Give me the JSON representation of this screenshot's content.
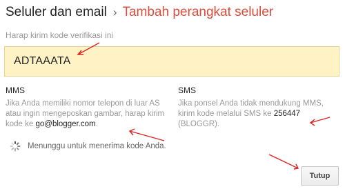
{
  "header": {
    "parent": "Seluler dan email",
    "separator": "›",
    "current": "Tambah perangkat seluler"
  },
  "verification": {
    "prompt": "Harap kirim kode verifikasi ini",
    "code": "ADTAAATA"
  },
  "mms": {
    "title": "MMS",
    "text_before": "Jika Anda memiliki nomor telepon di luar AS atau ingin mengeposkan gambar, harap kirim kode ke ",
    "address": "go@blogger.com",
    "text_after": "."
  },
  "sms": {
    "title": "SMS",
    "text_before": "Jika ponsel Anda tidak mendukung MMS, kirim kode melalui SMS ke ",
    "number": "256447",
    "text_after": " (BLOGGR)."
  },
  "status": {
    "waiting_text": "Menunggu untuk menerima kode Anda."
  },
  "actions": {
    "close_label": "Tutup"
  },
  "colors": {
    "accent": "#dd4b39",
    "code_box": "#fff3c5",
    "annotation_arrow": "#dd2222"
  }
}
